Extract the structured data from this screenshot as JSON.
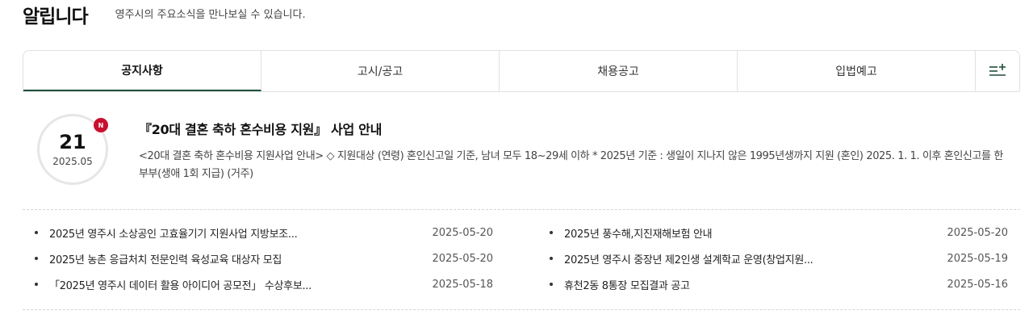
{
  "header": {
    "title": "알립니다",
    "subtitle": "영주시의 주요소식을 만나보실 수 있습니다."
  },
  "tabs": [
    {
      "label": "공지사항",
      "active": true
    },
    {
      "label": "고시/공고",
      "active": false
    },
    {
      "label": "채용공고",
      "active": false
    },
    {
      "label": "입법예고",
      "active": false
    }
  ],
  "more_icon": "menu-plus-icon",
  "featured": {
    "day": "21",
    "year_month": "2025.05",
    "badge": "N",
    "title": "『20대 결혼 축하 혼수비용 지원』 사업 안내",
    "summary": "<20대 결혼 축하 혼수비용 지원사업 안내>  ◇ 지원대상  (연령) 혼인신고일 기준, 남녀 모두 18~29세 이하  * 2025년 기준 : 생일이 지나지 않은 1995년생까지 지원  (혼인) 2025. 1. 1. 이후 혼인신고를 한 부부(생애 1회 지급)  (거주)"
  },
  "list_left": [
    {
      "title": "2025년 영주시 소상공인 고효율기기 지원사업 지방보조...",
      "date": "2025-05-20"
    },
    {
      "title": "2025년 농촌 응급처치 전문인력 육성교육 대상자 모집",
      "date": "2025-05-20"
    },
    {
      "title": "「2025년 영주시 데이터 활용 아이디어 공모전」 수상후보...",
      "date": "2025-05-18"
    }
  ],
  "list_right": [
    {
      "title": "2025년 풍수해,지진재해보험 안내",
      "date": "2025-05-20"
    },
    {
      "title": "2025년 영주시 중장년 제2인생 설계학교 운영(창업지원...",
      "date": "2025-05-19"
    },
    {
      "title": "휴천2동 8통장 모집결과 공고",
      "date": "2025-05-16"
    }
  ],
  "colors": {
    "accent": "#1f4f3a",
    "badge": "#c8102e"
  }
}
